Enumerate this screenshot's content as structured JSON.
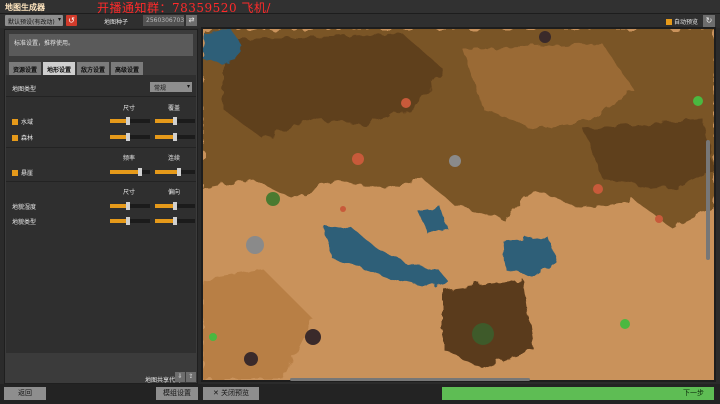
{
  "window": {
    "title": "地图生成器"
  },
  "overlay": {
    "text": "开播通知群：78359520   飞机/"
  },
  "topbar": {
    "preset": "默认预设(有改动)",
    "seed_label": "地图种子",
    "seed_value": "2560306703",
    "auto_generate_label": "自动预览"
  },
  "description": "标准设置，推荐使用。",
  "tabs": [
    "资源设置",
    "地形设置",
    "敌方设置",
    "高级设置"
  ],
  "terrain": {
    "map_type_label": "地图类型",
    "map_type_value": "常规",
    "group1": {
      "col1": "尺寸",
      "col2": "覆盖"
    },
    "water_label": "水域",
    "forest_label": "森林",
    "group2": {
      "col1": "频率",
      "col2": "连续"
    },
    "cliff_label": "悬崖",
    "group3": {
      "col1": "尺寸",
      "col2": "偏向"
    },
    "moisture_label": "地貌湿度",
    "terrain_type_label": "地貌类型"
  },
  "sliders": {
    "water": [
      0.45,
      0.5
    ],
    "forest": [
      0.45,
      0.5
    ],
    "cliff": [
      0.75,
      0.6
    ],
    "moisture": [
      0.45,
      0.5
    ],
    "terrain_type": [
      0.45,
      0.5
    ]
  },
  "share_label": "地图共享代码",
  "bottom": {
    "back": "返回",
    "map_settings": "模组设置",
    "close_preview": "关闭预览",
    "next": "下一步"
  },
  "colors": {
    "accent": "#e69a1a",
    "next_green": "#5ebd54",
    "red": "#d13b2b"
  }
}
